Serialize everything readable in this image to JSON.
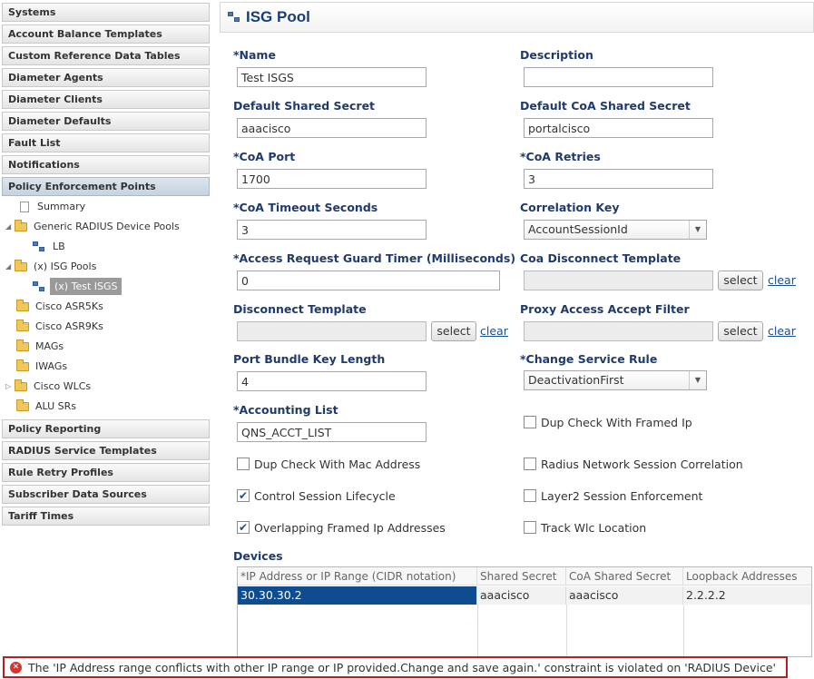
{
  "sidebar": {
    "top_items": [
      "Systems",
      "Account Balance Templates",
      "Custom Reference Data Tables",
      "Diameter Agents",
      "Diameter Clients",
      "Diameter Defaults",
      "Fault List",
      "Notifications",
      "Policy Enforcement Points"
    ],
    "tree": {
      "summary": "Summary",
      "generic_radius": "Generic RADIUS Device Pools",
      "lb": "LB",
      "isg_pools": "(x) ISG Pools",
      "test_isgs": "(x) Test ISGS",
      "cisco_asr5ks": "Cisco ASR5Ks",
      "cisco_asr9ks": "Cisco ASR9Ks",
      "mags": "MAGs",
      "iwags": "IWAGs",
      "cisco_wlcs": "Cisco WLCs",
      "alu_srs": "ALU SRs"
    },
    "bottom_items": [
      "Policy Reporting",
      "RADIUS Service Templates",
      "Rule Retry Profiles",
      "Subscriber Data Sources",
      "Tariff Times"
    ]
  },
  "panel": {
    "title": "ISG Pool"
  },
  "form": {
    "name_label": "*Name",
    "name_value": "Test ISGS",
    "description_label": "Description",
    "description_value": "",
    "default_shared_secret_label": "Default Shared Secret",
    "default_shared_secret_value": "aaacisco",
    "default_coa_shared_secret_label": "Default CoA Shared Secret",
    "default_coa_shared_secret_value": "portalcisco",
    "coa_port_label": "*CoA Port",
    "coa_port_value": "1700",
    "coa_retries_label": "*CoA Retries",
    "coa_retries_value": "3",
    "coa_timeout_label": "*CoA Timeout Seconds",
    "coa_timeout_value": "3",
    "correlation_key_label": "Correlation Key",
    "correlation_key_value": "AccountSessionId",
    "access_guard_label": "*Access Request Guard Timer (Milliseconds)",
    "access_guard_value": "0",
    "coa_disconnect_label": "Coa Disconnect Template",
    "disconnect_label": "Disconnect Template",
    "proxy_filter_label": "Proxy Access Accept Filter",
    "port_bundle_label": "Port Bundle Key Length",
    "port_bundle_value": "4",
    "change_service_label": "*Change Service Rule",
    "change_service_value": "DeactivationFirst",
    "accounting_list_label": "*Accounting List",
    "accounting_list_value": "QNS_ACCT_LIST",
    "select_label": "select",
    "clear_label": "clear"
  },
  "checkboxes": {
    "dup_framed_ip": {
      "label": "Dup Check With Framed Ip",
      "checked": false
    },
    "dup_mac": {
      "label": "Dup Check With Mac Address",
      "checked": false
    },
    "radius_corr": {
      "label": "Radius Network Session Correlation",
      "checked": false
    },
    "control_session": {
      "label": "Control Session Lifecycle",
      "checked": true
    },
    "layer2": {
      "label": "Layer2 Session Enforcement",
      "checked": false
    },
    "overlapping": {
      "label": "Overlapping Framed Ip Addresses",
      "checked": true
    },
    "track_wlc": {
      "label": "Track Wlc Location",
      "checked": false
    }
  },
  "devices": {
    "label": "Devices",
    "columns": [
      "*IP Address or IP Range (CIDR notation)",
      "Shared Secret",
      "CoA Shared Secret",
      "Loopback Addresses"
    ],
    "rows": [
      [
        "30.30.30.2",
        "aaacisco",
        "aaacisco",
        "2.2.2.2"
      ]
    ]
  },
  "error": {
    "message": "The 'IP Address range conflicts with other IP range or IP provided.Change and save again.' constraint is violated on 'RADIUS Device'"
  },
  "colors": {
    "selected_row": "#0f4c8f",
    "label": "#203a6b",
    "error_border": "#b22222"
  }
}
